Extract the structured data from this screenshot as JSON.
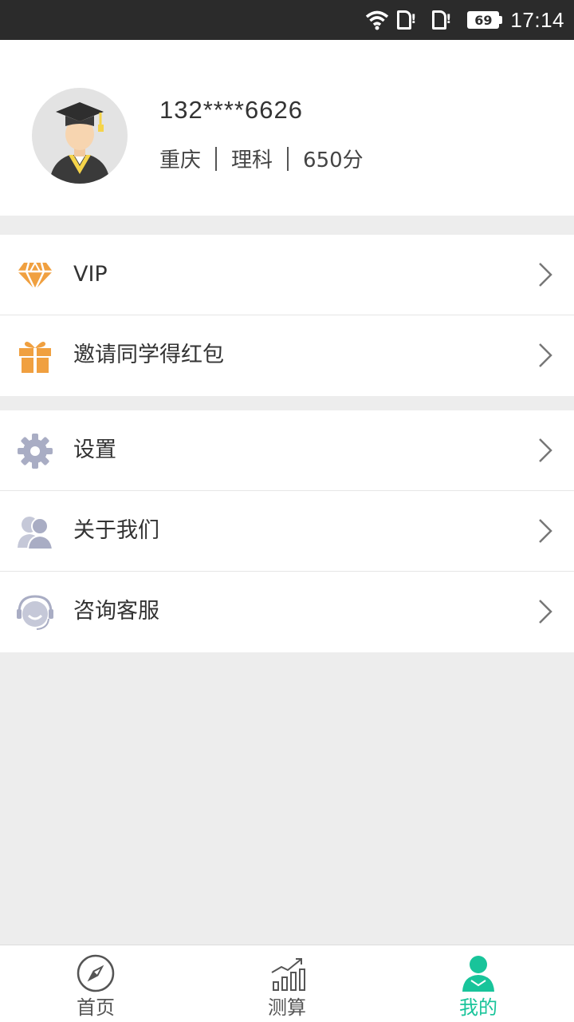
{
  "status_bar": {
    "battery": "69",
    "time": "17:14"
  },
  "profile": {
    "phone": "132****6626",
    "region": "重庆",
    "subject": "理科",
    "score": "650分"
  },
  "menu": {
    "group1": [
      {
        "label": "VIP",
        "icon": "diamond-icon"
      },
      {
        "label": "邀请同学得红包",
        "icon": "gift-icon"
      }
    ],
    "group2": [
      {
        "label": "设置",
        "icon": "gear-icon"
      },
      {
        "label": "关于我们",
        "icon": "users-icon"
      },
      {
        "label": "咨询客服",
        "icon": "customer-service-icon"
      }
    ]
  },
  "tabbar": [
    {
      "label": "首页",
      "icon": "compass-icon",
      "active": false
    },
    {
      "label": "测算",
      "icon": "chart-icon",
      "active": false
    },
    {
      "label": "我的",
      "icon": "person-icon",
      "active": true
    }
  ],
  "colors": {
    "accent": "#18c49a",
    "orange": "#f0a040",
    "icon_gray": "#a9adc4"
  }
}
